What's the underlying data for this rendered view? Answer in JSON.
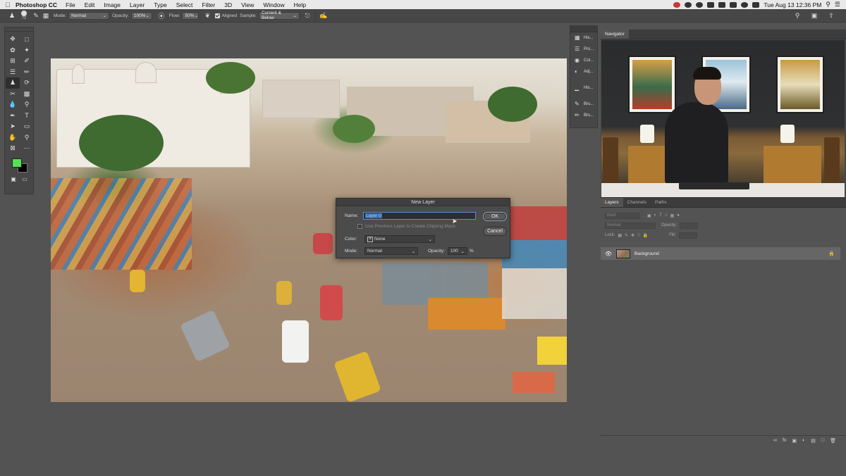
{
  "menubar": {
    "app_name": "Photoshop CC",
    "items": [
      "File",
      "Edit",
      "Image",
      "Layer",
      "Type",
      "Select",
      "Filter",
      "3D",
      "View",
      "Window",
      "Help"
    ],
    "clock": "Tue Aug 13  12:36 PM"
  },
  "options_bar": {
    "brush_size": "72",
    "mode_label": "Mode:",
    "mode_value": "Normal",
    "opacity_label": "Opacity:",
    "opacity_value": "100%",
    "flow_label": "Flow:",
    "flow_value": "50%",
    "aligned_label": "Aligned",
    "sample_label": "Sample:",
    "sample_value": "Current & Below"
  },
  "dialog": {
    "title": "New Layer",
    "name_label": "Name:",
    "name_value": "Layer 0",
    "clip_label": "Use Previous Layer to Create Clipping Mask",
    "color_label": "Color:",
    "color_value": "None",
    "mode_label": "Mode:",
    "mode_value": "Normal",
    "opacity_label": "Opacity:",
    "opacity_value": "100",
    "opacity_unit": "%",
    "ok_label": "OK",
    "cancel_label": "Cancel"
  },
  "icon_panel": {
    "items": [
      {
        "label": "His...",
        "icon": "history-icon"
      },
      {
        "label": "Pro...",
        "icon": "properties-icon"
      },
      {
        "label": "Col...",
        "icon": "color-icon"
      },
      {
        "label": "Adj...",
        "icon": "adjustments-icon"
      },
      {
        "label": "His...",
        "icon": "histogram-icon"
      },
      {
        "label": "Bru...",
        "icon": "brush-icon"
      },
      {
        "label": "Bru...",
        "icon": "brush-settings-icon"
      }
    ]
  },
  "navigator": {
    "tab": "Navigator"
  },
  "layers_panel": {
    "tabs": [
      "Layers",
      "Channels",
      "Paths"
    ],
    "kind_placeholder": "Kind",
    "blend_mode": "Normal",
    "opacity_label": "Opacity:",
    "lock_label": "Lock:",
    "fill_label": "Fill:",
    "layer_name": "Background"
  },
  "colors": {
    "foreground": "#55e055",
    "background": "#000000",
    "ui_bg": "#535353",
    "panel_bg": "#474747",
    "selection": "#3a6fb8"
  }
}
